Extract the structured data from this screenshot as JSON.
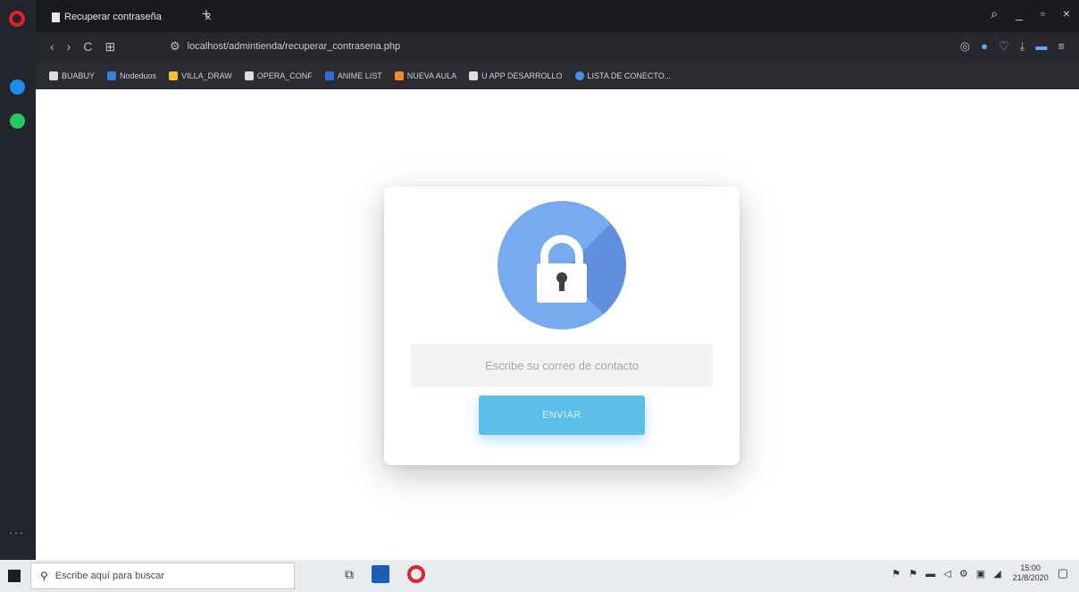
{
  "browser": {
    "tab_title": "Recuperar contraseña",
    "tab_close": "×",
    "new_tab": "+",
    "url": "localhost/admintienda/recuperar_contrasena.php",
    "nav": {
      "back": "‹",
      "forward": "›",
      "reload": "C",
      "speed_dial": "⊞"
    },
    "window_controls": {
      "search": "⌕",
      "minimize": "_",
      "maximize": "▫",
      "close": "×"
    },
    "toolbar_icons": [
      "◎",
      "●",
      "♡",
      "⤓",
      "▬",
      "≡"
    ],
    "bookmarks": [
      {
        "label": "BUABUY",
        "icon": "page-icon"
      },
      {
        "label": "Nodeduos",
        "icon": "facebook-icon"
      },
      {
        "label": "VILLA_DRAW",
        "icon": "drive-icon"
      },
      {
        "label": "OPERA_CONF",
        "icon": "gear-icon"
      },
      {
        "label": "ANIME LIST",
        "icon": "list-icon"
      },
      {
        "label": "NUEVA AULA",
        "icon": "aula-icon"
      },
      {
        "label": "U APP DESARROLLO",
        "icon": "page-icon"
      },
      {
        "label": "LISTA DE CONECTO...",
        "icon": "globe-icon"
      }
    ],
    "sidebar_more": "···"
  },
  "page": {
    "lock_icon": "lock-icon",
    "email_placeholder": "Escribe su correo de contacto",
    "email_value": "",
    "send_button": "ENVIAR"
  },
  "taskbar": {
    "search_placeholder": "Escribe aquí para buscar",
    "tray_icons": "⚑ ⚑ ▬   ◁ ⚙ ▣ ◢",
    "time": "15:00",
    "date": "21/8/2020",
    "notification_icon": "▢"
  },
  "colors": {
    "lock_circle": "#78aaf0",
    "send_button": "#5bbfe9",
    "opera_red": "#e0232b"
  }
}
